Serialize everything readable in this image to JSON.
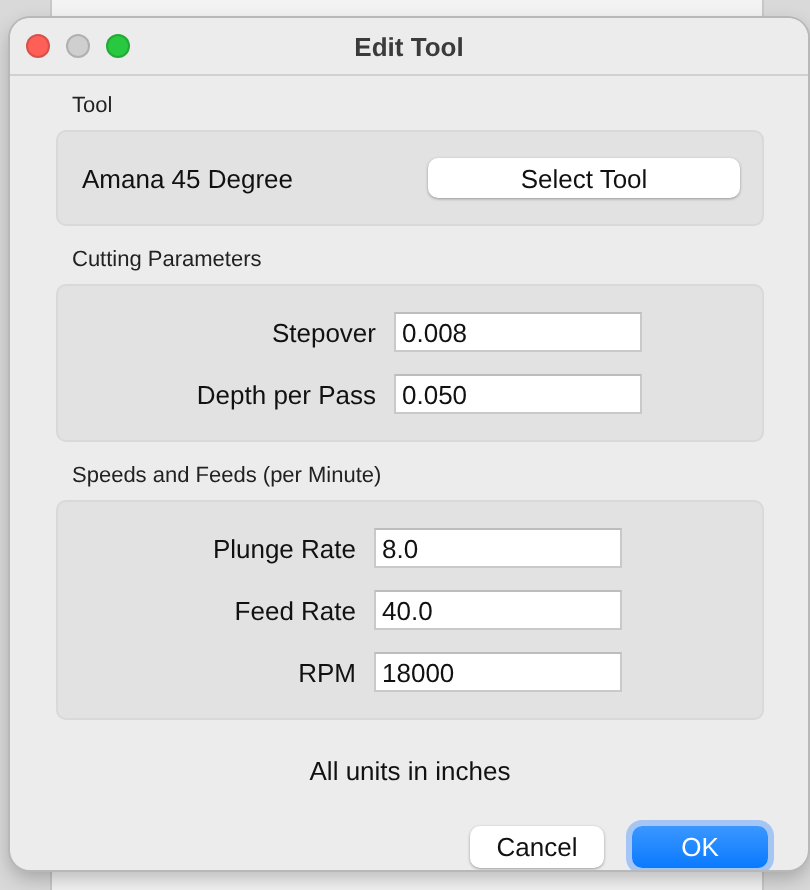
{
  "window": {
    "title": "Edit Tool",
    "controls": [
      {
        "kind": "close",
        "disabled": false
      },
      {
        "kind": "minimize",
        "disabled": true
      },
      {
        "kind": "zoom",
        "disabled": false
      }
    ]
  },
  "tool_group": {
    "label": "Tool",
    "tool_name": "Amana 45 Degree",
    "button": "Select Tool"
  },
  "field_groups": [
    {
      "label": "Cutting Parameters",
      "fields": [
        {
          "label": "Stepover",
          "value": "0.008"
        },
        {
          "label": "Depth per Pass",
          "value": "0.050"
        }
      ]
    },
    {
      "label": "Speeds and Feeds (per Minute)",
      "fields": [
        {
          "label": "Plunge Rate",
          "value": "8.0"
        },
        {
          "label": "Feed Rate",
          "value": "40.0"
        },
        {
          "label": "RPM",
          "value": "18000"
        }
      ]
    }
  ],
  "note": "All units in inches",
  "buttons": [
    {
      "label": "Cancel",
      "kind": "normal"
    },
    {
      "label": "OK",
      "kind": "default"
    }
  ]
}
